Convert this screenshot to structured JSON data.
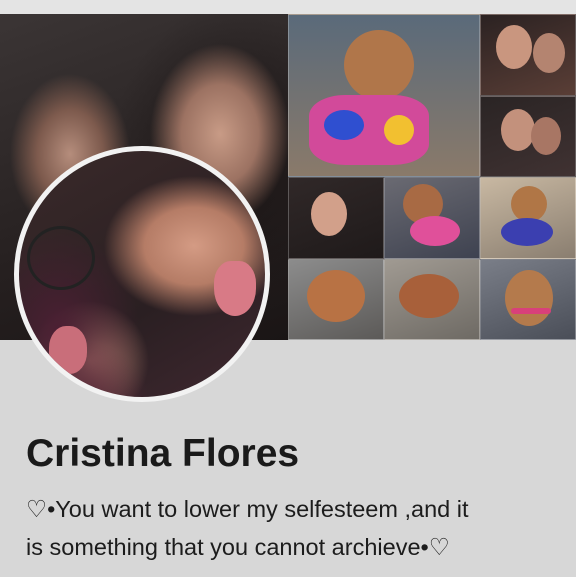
{
  "profile": {
    "name": "Cristina Flores",
    "bio_line1": "♡•You want to lower my selfesteem ,and it",
    "bio_line2": "is  something that you cannot archieve•♡"
  },
  "cover": {
    "photo_grid_count": 11
  },
  "colors": {
    "background": "#d7d7d7",
    "name_text": "#1a1a1a",
    "avatar_ring": "#f2f2f2"
  }
}
